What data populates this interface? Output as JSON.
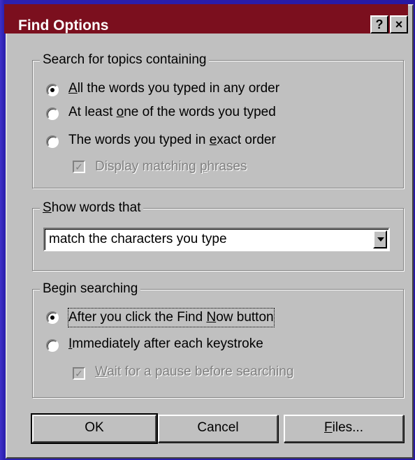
{
  "dialog": {
    "title": "Find Options",
    "help_button": "?",
    "close_button": "×"
  },
  "search_group": {
    "legend": "Search for topics containing",
    "options": [
      {
        "pre": "",
        "key": "A",
        "post": "ll the words you typed in any order",
        "selected": true
      },
      {
        "pre": "At least ",
        "key": "o",
        "post": "ne of the words you typed",
        "selected": false
      },
      {
        "pre": "The words you typed in ",
        "key": "e",
        "post": "xact order",
        "selected": false
      }
    ],
    "phrases": {
      "pre": "Display matching ",
      "key": "p",
      "post": "hrases",
      "checked": true,
      "enabled": false
    }
  },
  "show_group": {
    "legend_key": "S",
    "legend_rest": "how words that",
    "select_value": "match the characters you type"
  },
  "begin_group": {
    "legend": "Begin searching",
    "options": [
      {
        "pre": "After you click the Find ",
        "key": "N",
        "post": "ow button",
        "selected": true
      },
      {
        "pre": "",
        "key": "I",
        "post": "mmediately after each keystroke",
        "selected": false
      }
    ],
    "pause": {
      "pre": "",
      "key": "W",
      "post": "ait for a pause before searching",
      "checked": true,
      "enabled": false
    }
  },
  "buttons": {
    "ok": "OK",
    "cancel": "Cancel",
    "files_key": "F",
    "files_rest": "iles..."
  },
  "colors": {
    "titlebar": "#7b0f1e",
    "face": "#c0c0c0",
    "backdrop": "#2a1fa8"
  }
}
